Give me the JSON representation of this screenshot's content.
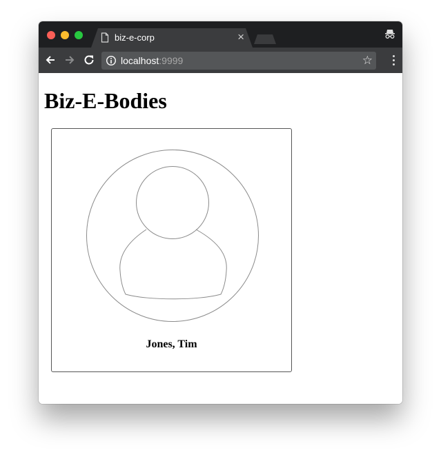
{
  "browser": {
    "tab": {
      "title": "biz-e-corp",
      "close_glyph": "×",
      "icon": "document-icon"
    },
    "url": {
      "host": "localhost",
      "port": ":9999"
    },
    "colors": {
      "chrome_dark": "#1e1f21",
      "toolbar": "#3b3c3e",
      "omnibox": "#545658"
    }
  },
  "page": {
    "heading": "Biz-E-Bodies",
    "people": [
      {
        "name": "Jones, Tim",
        "avatar_icon": "user-avatar-icon"
      }
    ]
  }
}
